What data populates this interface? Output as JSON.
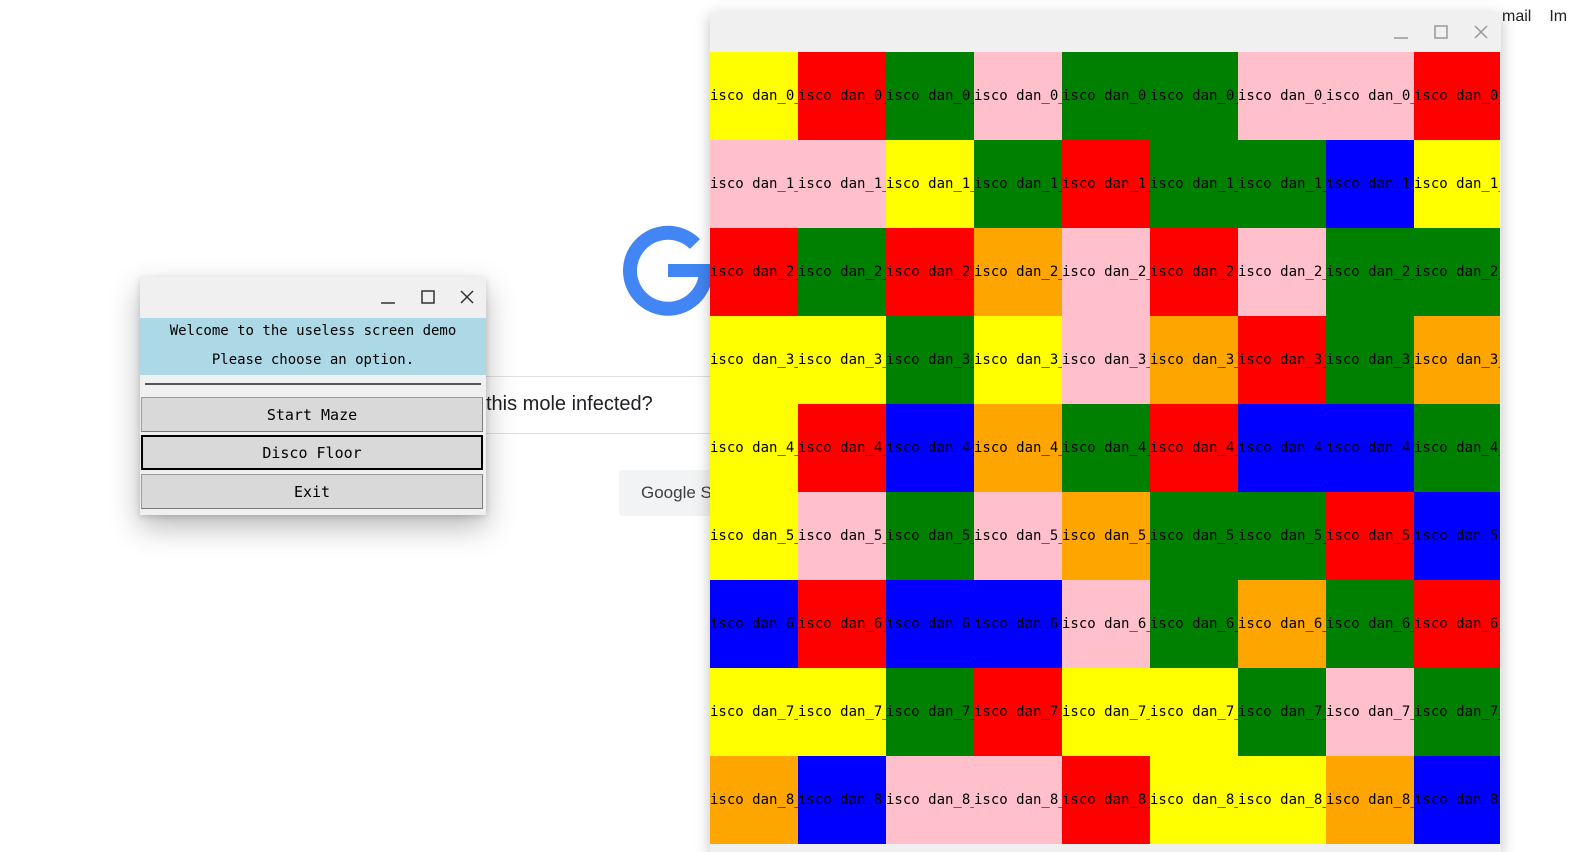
{
  "browser": {
    "top_links": [
      "mail",
      "Im"
    ],
    "search_text": "this mole infected?",
    "search_button": "Google S"
  },
  "menu_window": {
    "welcome": "Welcome to the useless screen demo",
    "prompt": "Please choose an option.",
    "buttons": [
      "Start Maze",
      "Disco Floor",
      "Exit"
    ],
    "focused_button": "Disco Floor"
  },
  "disco_window": {
    "palette": {
      "Y": "#ffff00",
      "R": "#ff0000",
      "G": "#008000",
      "P": "#ffc0cb",
      "O": "#ffa500",
      "B": "#0000ff"
    },
    "rows": [
      {
        "label": "isco dan_0_",
        "colors": [
          "Y",
          "R",
          "G",
          "P",
          "G",
          "G",
          "P",
          "P",
          "R"
        ]
      },
      {
        "label": "isco dan_1_",
        "colors": [
          "P",
          "P",
          "Y",
          "G",
          "R",
          "G",
          "G",
          "B",
          "Y"
        ]
      },
      {
        "label": "isco dan_2_",
        "colors": [
          "R",
          "G",
          "R",
          "O",
          "P",
          "R",
          "P",
          "G",
          "G"
        ]
      },
      {
        "label": "isco dan_3_",
        "colors": [
          "Y",
          "Y",
          "G",
          "Y",
          "P",
          "O",
          "R",
          "G",
          "O"
        ]
      },
      {
        "label": "isco dan_4_",
        "colors": [
          "Y",
          "R",
          "B",
          "O",
          "G",
          "R",
          "B",
          "B",
          "G"
        ]
      },
      {
        "label": "isco dan_5_",
        "colors": [
          "Y",
          "P",
          "G",
          "P",
          "O",
          "G",
          "G",
          "R",
          "B"
        ]
      },
      {
        "label": "isco dan_6_",
        "colors": [
          "B",
          "R",
          "B",
          "B",
          "P",
          "G",
          "O",
          "G",
          "R"
        ]
      },
      {
        "label": "isco dan_7_",
        "colors": [
          "Y",
          "Y",
          "G",
          "R",
          "Y",
          "Y",
          "G",
          "P",
          "G"
        ]
      },
      {
        "label": "isco dan_8_",
        "colors": [
          "O",
          "B",
          "P",
          "P",
          "R",
          "Y",
          "Y",
          "O",
          "B"
        ]
      }
    ]
  }
}
